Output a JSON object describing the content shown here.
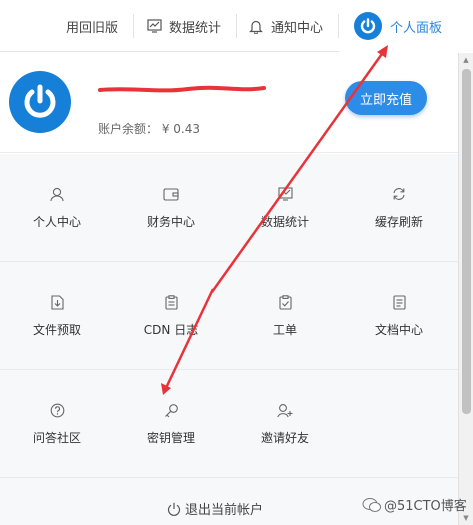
{
  "topnav": {
    "old_version": "用回旧版",
    "stats": "数据统计",
    "notifications": "通知中心",
    "personal_panel": "个人面板"
  },
  "profile": {
    "username": "••••••••••••••••••",
    "balance_label": "账户余额：",
    "balance_value": "¥ 0.43",
    "recharge_label": "立即充值"
  },
  "grid": {
    "row1": [
      "个人中心",
      "财务中心",
      "数据统计",
      "缓存刷新"
    ],
    "row2": [
      "文件预取",
      "CDN 日志",
      "工单",
      "文档中心"
    ],
    "row3": [
      "问答社区",
      "密钥管理",
      "邀请好友"
    ]
  },
  "logout_label": "退出当前帐户",
  "watermark": "@51CTO博客",
  "colors": {
    "brand_blue": "#1680d8",
    "button_blue": "#2d8ce8",
    "annotation_red": "#e8333a"
  }
}
